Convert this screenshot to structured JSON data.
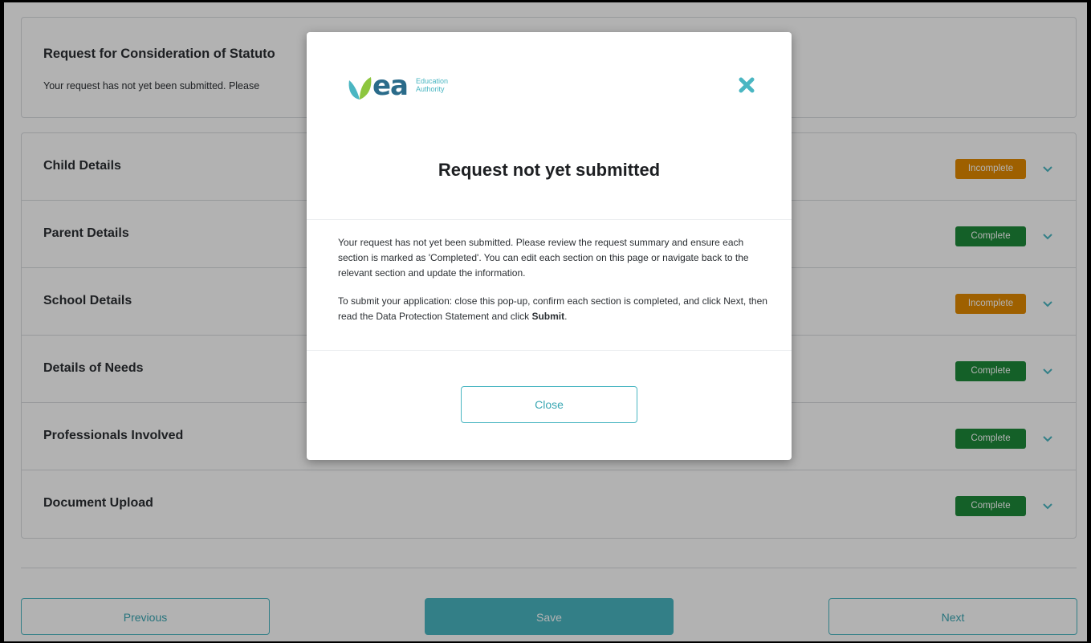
{
  "header": {
    "title": "Request for Consideration of Statuto",
    "subtitle": "Your request has not yet been submitted. Please"
  },
  "sections": [
    {
      "label": "Child Details",
      "status": "Incomplete"
    },
    {
      "label": "Parent Details",
      "status": "Complete"
    },
    {
      "label": "School Details",
      "status": "Incomplete"
    },
    {
      "label": "Details of Needs",
      "status": "Complete"
    },
    {
      "label": "Professionals Involved",
      "status": "Complete"
    },
    {
      "label": "Document Upload",
      "status": "Complete"
    }
  ],
  "footer": {
    "previous_label": "Previous",
    "save_label": "Save",
    "next_label": "Next"
  },
  "modal": {
    "logo_text": "ea",
    "logo_line1": "Education",
    "logo_line2": "Authority",
    "title": "Request not yet submitted",
    "para1": "Your request has not yet been submitted. Please review the request summary and ensure each section is marked as 'Completed'. You can edit each section on this page or navigate back to the relevant section and update the information.",
    "para2_prefix": "To submit your application: close this pop-up, confirm each section is completed, and click Next, then read the Data Protection Statement and click ",
    "para2_bold": "Submit",
    "para2_suffix": ".",
    "close_label": "Close"
  },
  "colors": {
    "accent": "#4ab6c2",
    "incomplete": "#e38a00",
    "complete": "#1e8a3a"
  }
}
